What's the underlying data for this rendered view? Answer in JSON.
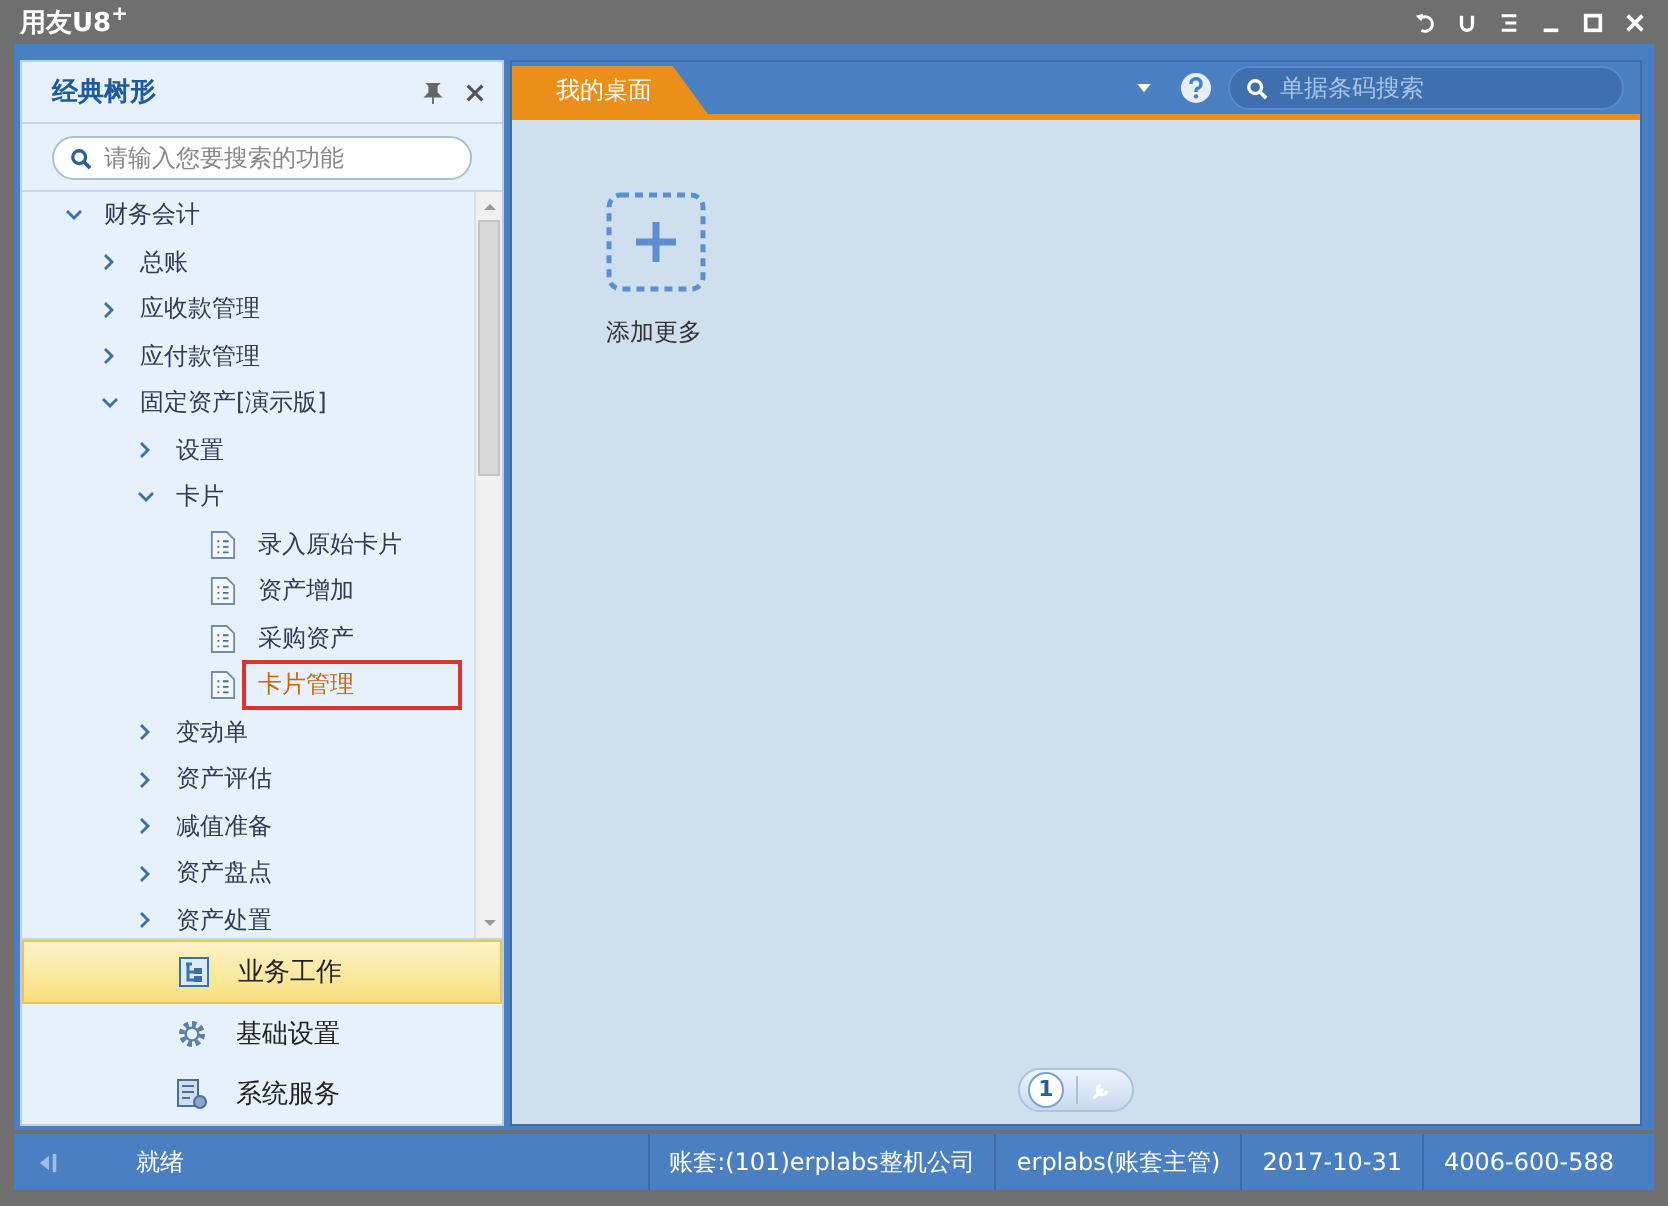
{
  "window": {
    "title": "用友U8$^{+}$"
  },
  "left_panel": {
    "title": "经典树形",
    "search": {
      "placeholder": "请输入您要搜索的功能"
    },
    "tree": [
      {
        "label": "财务会计",
        "kind": "folder",
        "expanded": true,
        "selected": false,
        "children": [
          {
            "label": "总账",
            "kind": "folder",
            "expanded": false,
            "selected": false
          },
          {
            "label": "应收款管理",
            "kind": "folder",
            "expanded": false,
            "selected": false
          },
          {
            "label": "应付款管理",
            "kind": "folder",
            "expanded": false,
            "selected": false
          },
          {
            "label": "固定资产[演示版]",
            "kind": "folder",
            "expanded": true,
            "selected": false,
            "children": [
              {
                "label": "设置",
                "kind": "folder",
                "expanded": false,
                "selected": false
              },
              {
                "label": "卡片",
                "kind": "folder",
                "expanded": true,
                "selected": false,
                "children": [
                  {
                    "label": "录入原始卡片",
                    "kind": "leaf",
                    "selected": false
                  },
                  {
                    "label": "资产增加",
                    "kind": "leaf",
                    "selected": false
                  },
                  {
                    "label": "采购资产",
                    "kind": "leaf",
                    "selected": false
                  },
                  {
                    "label": "卡片管理",
                    "kind": "leaf",
                    "selected": true
                  }
                ]
              },
              {
                "label": "变动单",
                "kind": "folder",
                "expanded": false,
                "selected": false
              },
              {
                "label": "资产评估",
                "kind": "folder",
                "expanded": false,
                "selected": false
              },
              {
                "label": "减值准备",
                "kind": "folder",
                "expanded": false,
                "selected": false
              },
              {
                "label": "资产盘点",
                "kind": "folder",
                "expanded": false,
                "selected": false
              },
              {
                "label": "资产处置",
                "kind": "folder",
                "expanded": false,
                "selected": false
              }
            ]
          }
        ]
      }
    ],
    "nav": [
      {
        "label": "业务工作",
        "kind": "work",
        "selected": true
      },
      {
        "label": "基础设置",
        "kind": "settings",
        "selected": false
      },
      {
        "label": "系统服务",
        "kind": "service",
        "selected": false
      }
    ]
  },
  "tabs": [
    {
      "label": "我的桌面",
      "selected": true
    }
  ],
  "doc_search": {
    "placeholder": "单据条码搜索"
  },
  "desktop": {
    "add_tile": {
      "label": "添加更多"
    },
    "pager": [
      {
        "label": "1",
        "kind": "page",
        "selected": true
      },
      {
        "kind": "tool",
        "selected": false
      }
    ]
  },
  "status_bar": {
    "state": "就绪",
    "account": "账套:(101)erplabs整机公司",
    "user": "erplabs(账套主管)",
    "date": "2017-10-31",
    "phone": "4006-600-588"
  }
}
